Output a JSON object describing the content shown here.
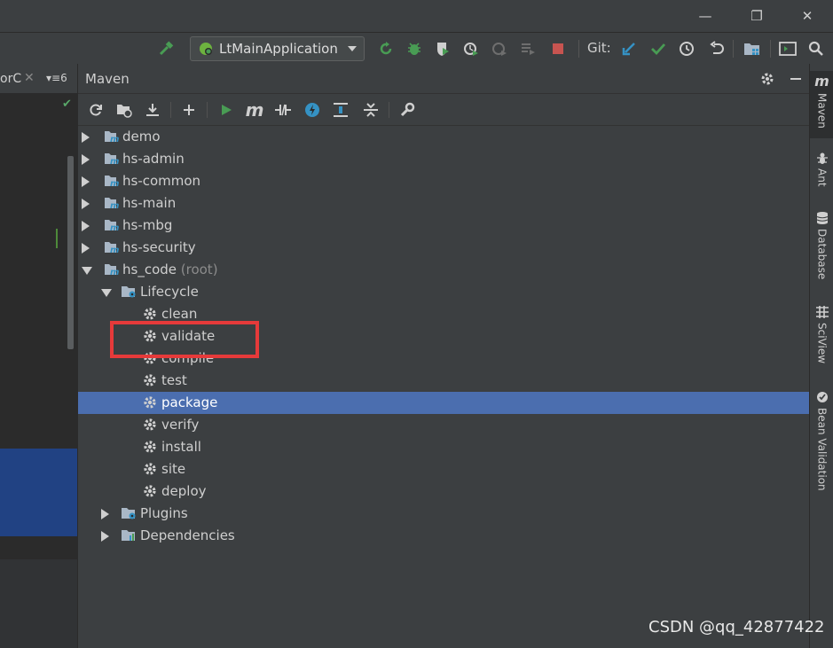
{
  "window": {
    "minimize": "—",
    "restore": "❐",
    "close": "✕"
  },
  "navbar": {
    "run_config": "LtMainApplication",
    "git_label": "Git:",
    "icons": [
      "hammer-icon",
      "run-icon",
      "debug-icon",
      "coverage-icon",
      "profile-icon",
      "attach-icon",
      "build-icon",
      "stop-icon",
      "git-update-icon",
      "git-commit-icon",
      "history-icon",
      "rollback-icon",
      "project-structure-icon",
      "terminal-icon",
      "search-icon"
    ]
  },
  "editor": {
    "tab_text": "orC",
    "tab_close": "✕",
    "tab_count": "▾≡6"
  },
  "maven": {
    "title": "Maven",
    "tree": [
      {
        "label": "demo",
        "type": "module",
        "level": 0,
        "expanded": false
      },
      {
        "label": "hs-admin",
        "type": "module",
        "level": 0,
        "expanded": false
      },
      {
        "label": "hs-common",
        "type": "module",
        "level": 0,
        "expanded": false
      },
      {
        "label": "hs-main",
        "type": "module",
        "level": 0,
        "expanded": false
      },
      {
        "label": "hs-mbg",
        "type": "module",
        "level": 0,
        "expanded": false
      },
      {
        "label": "hs-security",
        "type": "module",
        "level": 0,
        "expanded": false
      },
      {
        "label": "hs_code",
        "suffix": "(root)",
        "type": "module",
        "level": 0,
        "expanded": true
      },
      {
        "label": "Lifecycle",
        "type": "folder",
        "level": 1,
        "expanded": true
      },
      {
        "label": "clean",
        "type": "goal",
        "level": 2
      },
      {
        "label": "validate",
        "type": "goal",
        "level": 2
      },
      {
        "label": "compile",
        "type": "goal",
        "level": 2
      },
      {
        "label": "test",
        "type": "goal",
        "level": 2
      },
      {
        "label": "package",
        "type": "goal",
        "level": 2,
        "selected": true
      },
      {
        "label": "verify",
        "type": "goal",
        "level": 2
      },
      {
        "label": "install",
        "type": "goal",
        "level": 2
      },
      {
        "label": "site",
        "type": "goal",
        "level": 2
      },
      {
        "label": "deploy",
        "type": "goal",
        "level": 2
      },
      {
        "label": "Plugins",
        "type": "folder",
        "level": 1,
        "expanded": false
      },
      {
        "label": "Dependencies",
        "type": "deps",
        "level": 1,
        "expanded": false
      }
    ]
  },
  "right_stripe": {
    "maven": "Maven",
    "ant": "Ant",
    "database": "Database",
    "sciview": "SciView",
    "bean_validation": "Bean Validation"
  },
  "watermark": "CSDN @qq_42877422",
  "colors": {
    "selection": "#4b6eaf",
    "highlight": "#e63a3a",
    "accent_green": "#499c54",
    "accent_blue": "#3592c4"
  }
}
